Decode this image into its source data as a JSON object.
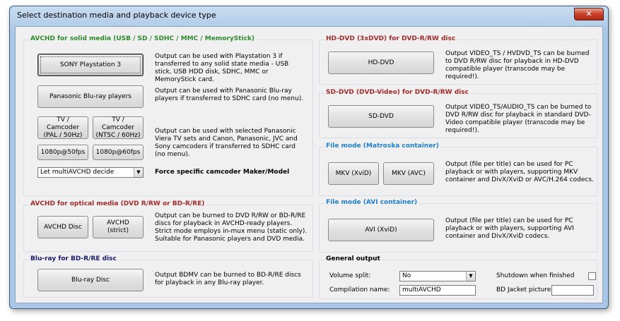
{
  "window": {
    "title": "Select destination media and playback device type",
    "close_glyph": "✕"
  },
  "colors": {
    "green_title": "#2e8b2e",
    "red_title": "#a52a2a",
    "blue_title": "#1e7fd0",
    "navy_title": "#1a1a6e"
  },
  "avchd_solid": {
    "title": "AVCHD for solid media (USB / SD / SDHC / MMC / MemoryStick)",
    "ps3_button": "SONY Playstation 3",
    "ps3_desc": "Output can be used with Playstation 3 if transferred to any solid state media - USB stick, USB HDD disk, SDHC, MMC or MemoryStick card.",
    "panasonic_button": "Panasonic Blu-ray players",
    "panasonic_desc": "Output can be used with Panasonic Blu-ray players if transferred to SDHC card (no menu).",
    "tv_pal_button": "TV / Camcoder (PAL / 50Hz)",
    "tv_ntsc_button": "TV / Camcoder (NTSC / 60Hz)",
    "p50_button": "1080p@50fps",
    "p60_button": "1080p@60fps",
    "camcorder_desc": "Output can be used with selected Panasonic Viera TV sets and Canon, Panasonic, JVC and Sony camcoders if transferred to SDHC card (no menu).",
    "maker_select": "Let multiAVCHD decide",
    "maker_label": "Force specific camcoder Maker/Model"
  },
  "avchd_optical": {
    "title": "AVCHD for optical media (DVD R/RW or BD-R/RE)",
    "disc_button": "AVCHD Disc",
    "strict_button": "AVCHD (strict)",
    "desc": "Output can be burned to DVD R/RW or BD-R/RE discs for playback in AVCHD-ready players. Strict mode employs in-mux menu (static only). Suitable for Panasonic players and DVD media."
  },
  "bluray": {
    "title": "Blu-ray for BD-R/RE disc",
    "button": "Blu-ray Disc",
    "desc": "Output BDMV can be burned to BD-R/RE discs for playback in any Blu-ray player."
  },
  "hddvd": {
    "title": "HD-DVD (3xDVD) for DVD-R/RW disc",
    "button": "HD-DVD",
    "desc": "Output VIDEO_TS / HVDVD_TS can be burned to DVD R/RW disc for playback in HD-DVD compatible player (transcode may be required!)."
  },
  "sddvd": {
    "title": "SD-DVD (DVD-Video) for DVD-R/RW disc",
    "button": "SD-DVD",
    "desc": "Output VIDEO_TS/AUDIO_TS can be burned to DVD R/RW disc for playback in standard DVD-Video compatible player (transcode may be required!)."
  },
  "mkv": {
    "title": "File mode (Matroska container)",
    "xvid_button": "MKV (XviD)",
    "avc_button": "MKV (AVC)",
    "desc": "Output (file per title) can be used for PC playback or with players, supporting MKV container and DivX/XviD or AVC/H.264 codecs."
  },
  "avi": {
    "title": "File mode (AVI container)",
    "button": "AVI (XviD)",
    "desc": "Output (file per title) can be used for PC playback or with players, supporting AVI container and DivX/XviD codecs."
  },
  "general": {
    "title": "General output",
    "volume_split_label": "Volume split:",
    "volume_split_value": "No",
    "compilation_label": "Compilation name:",
    "compilation_value": "multiAVCHD",
    "shutdown_label": "Shutdown when finished",
    "bd_jacket_label": "BD Jacket picture:",
    "bd_jacket_value": ""
  }
}
